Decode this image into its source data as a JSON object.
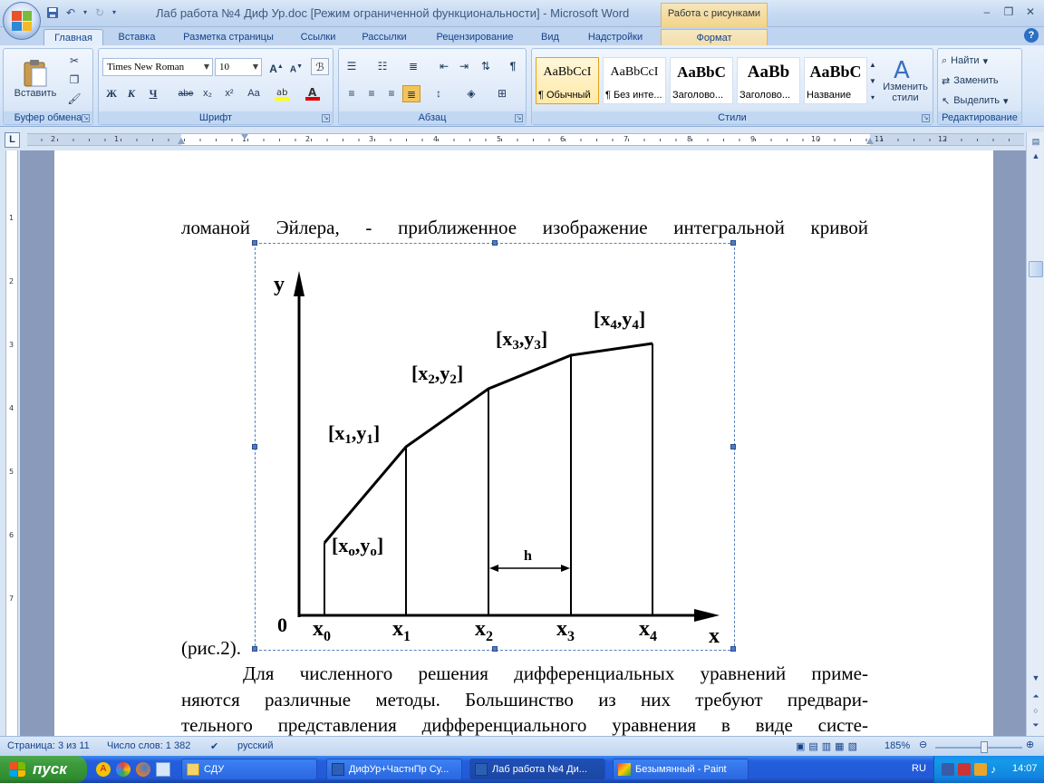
{
  "window": {
    "title": "Лаб работа №4 Диф Ур.doc [Режим ограниченной функциональности] - Microsoft Word",
    "context_tab_title": "Работа с рисунками",
    "controls": {
      "minimize": "–",
      "restore": "❐",
      "close": "✕"
    }
  },
  "tabs": [
    {
      "label": "Главная",
      "active": true
    },
    {
      "label": "Вставка"
    },
    {
      "label": "Разметка страницы"
    },
    {
      "label": "Ссылки"
    },
    {
      "label": "Рассылки"
    },
    {
      "label": "Рецензирование"
    },
    {
      "label": "Вид"
    },
    {
      "label": "Надстройки"
    },
    {
      "label": "Формат"
    }
  ],
  "ribbon": {
    "clipboard": {
      "label": "Буфер обмена",
      "paste": "Вставить"
    },
    "font": {
      "label": "Шрифт",
      "font_name": "Times New Roman",
      "font_size": "10",
      "bold": "Ж",
      "italic": "К",
      "underline": "Ч",
      "strike": "abe",
      "sub": "x₂",
      "sup": "x²",
      "case": "Aa"
    },
    "paragraph": {
      "label": "Абзац"
    },
    "styles": {
      "label": "Стили",
      "items": [
        {
          "sample": "AaBbCcI",
          "name": "¶ Обычный"
        },
        {
          "sample": "AaBbCcI",
          "name": "¶ Без инте..."
        },
        {
          "sample": "AaBbC",
          "name": "Заголово..."
        },
        {
          "sample": "AaBb",
          "name": "Заголово..."
        },
        {
          "sample": "AaBbC",
          "name": "Название"
        }
      ],
      "change_styles": "Изменить стили"
    },
    "editing": {
      "label": "Редактирование",
      "find": "Найти",
      "replace": "Заменить",
      "select": "Выделить"
    }
  },
  "ruler_numbers": [
    "2",
    "1",
    "1",
    "2",
    "3",
    "4",
    "5",
    "6",
    "7",
    "8",
    "9",
    "10",
    "11",
    "12"
  ],
  "vruler_numbers": [
    "1",
    "2",
    "3",
    "4",
    "5",
    "6",
    "7"
  ],
  "document": {
    "line1": "ломаной Эйлера, - приближенное изображение интегральной кривой",
    "fig_ref": "(рис.2).",
    "para1": "Для численного решения дифференциальных уравнений приме-",
    "para2": "няются различные методы. Большинство из них требуют предвари-",
    "para3": "тельного представления дифференциального уравнения в виде систе-"
  },
  "figure": {
    "y_axis": "y",
    "x_axis": "x",
    "origin": "0",
    "step": "h",
    "x_ticks": [
      {
        "base": "x",
        "sub": "0"
      },
      {
        "base": "x",
        "sub": "1"
      },
      {
        "base": "x",
        "sub": "2"
      },
      {
        "base": "x",
        "sub": "3"
      },
      {
        "base": "x",
        "sub": "4"
      }
    ],
    "points": [
      {
        "label": "[x",
        "sub1": "o",
        "mid": ",y",
        "sub2": "o",
        "end": "]"
      },
      {
        "label": "[x",
        "sub1": "1",
        "mid": ",y",
        "sub2": "1",
        "end": "]"
      },
      {
        "label": "[x",
        "sub1": "2",
        "mid": ",y",
        "sub2": "2",
        "end": "]"
      },
      {
        "label": "[x",
        "sub1": "3",
        "mid": ",y",
        "sub2": "3",
        "end": "]"
      },
      {
        "label": "[x",
        "sub1": "4",
        "mid": ",y",
        "sub2": "4",
        "end": "]"
      }
    ]
  },
  "statusbar": {
    "page": "Страница: 3 из 11",
    "words": "Число слов: 1 382",
    "language": "русский",
    "zoom": "185%"
  },
  "taskbar": {
    "start": "пуск",
    "tasks": [
      {
        "label": "СДУ"
      },
      {
        "label": "ДифУр+ЧастнПр Су..."
      },
      {
        "label": "Лаб работа №4 Ди...",
        "active": true
      },
      {
        "label": "Безымянный - Paint"
      }
    ],
    "lang": "RU",
    "time": "14:07"
  }
}
